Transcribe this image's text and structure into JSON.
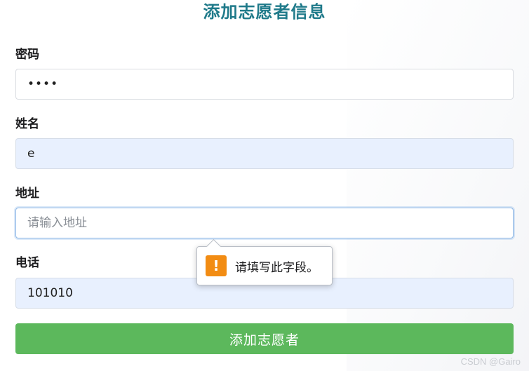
{
  "form": {
    "title": "添加志愿者信息",
    "password": {
      "label": "密码",
      "value": "••••"
    },
    "name": {
      "label": "姓名",
      "value": "e"
    },
    "address": {
      "label": "地址",
      "value": "",
      "placeholder": "请输入地址"
    },
    "phone": {
      "label": "电话",
      "value": "101010"
    },
    "submit_label": "添加志愿者"
  },
  "validation_tooltip": {
    "icon": "warning-icon",
    "icon_glyph": "!",
    "message": "请填写此字段。",
    "icon_color": "#f28c13"
  },
  "watermark": "CSDN @Gairo",
  "colors": {
    "title": "#1f7a8a",
    "submit": "#5cb85c",
    "autofill": "#e8f0fe"
  }
}
